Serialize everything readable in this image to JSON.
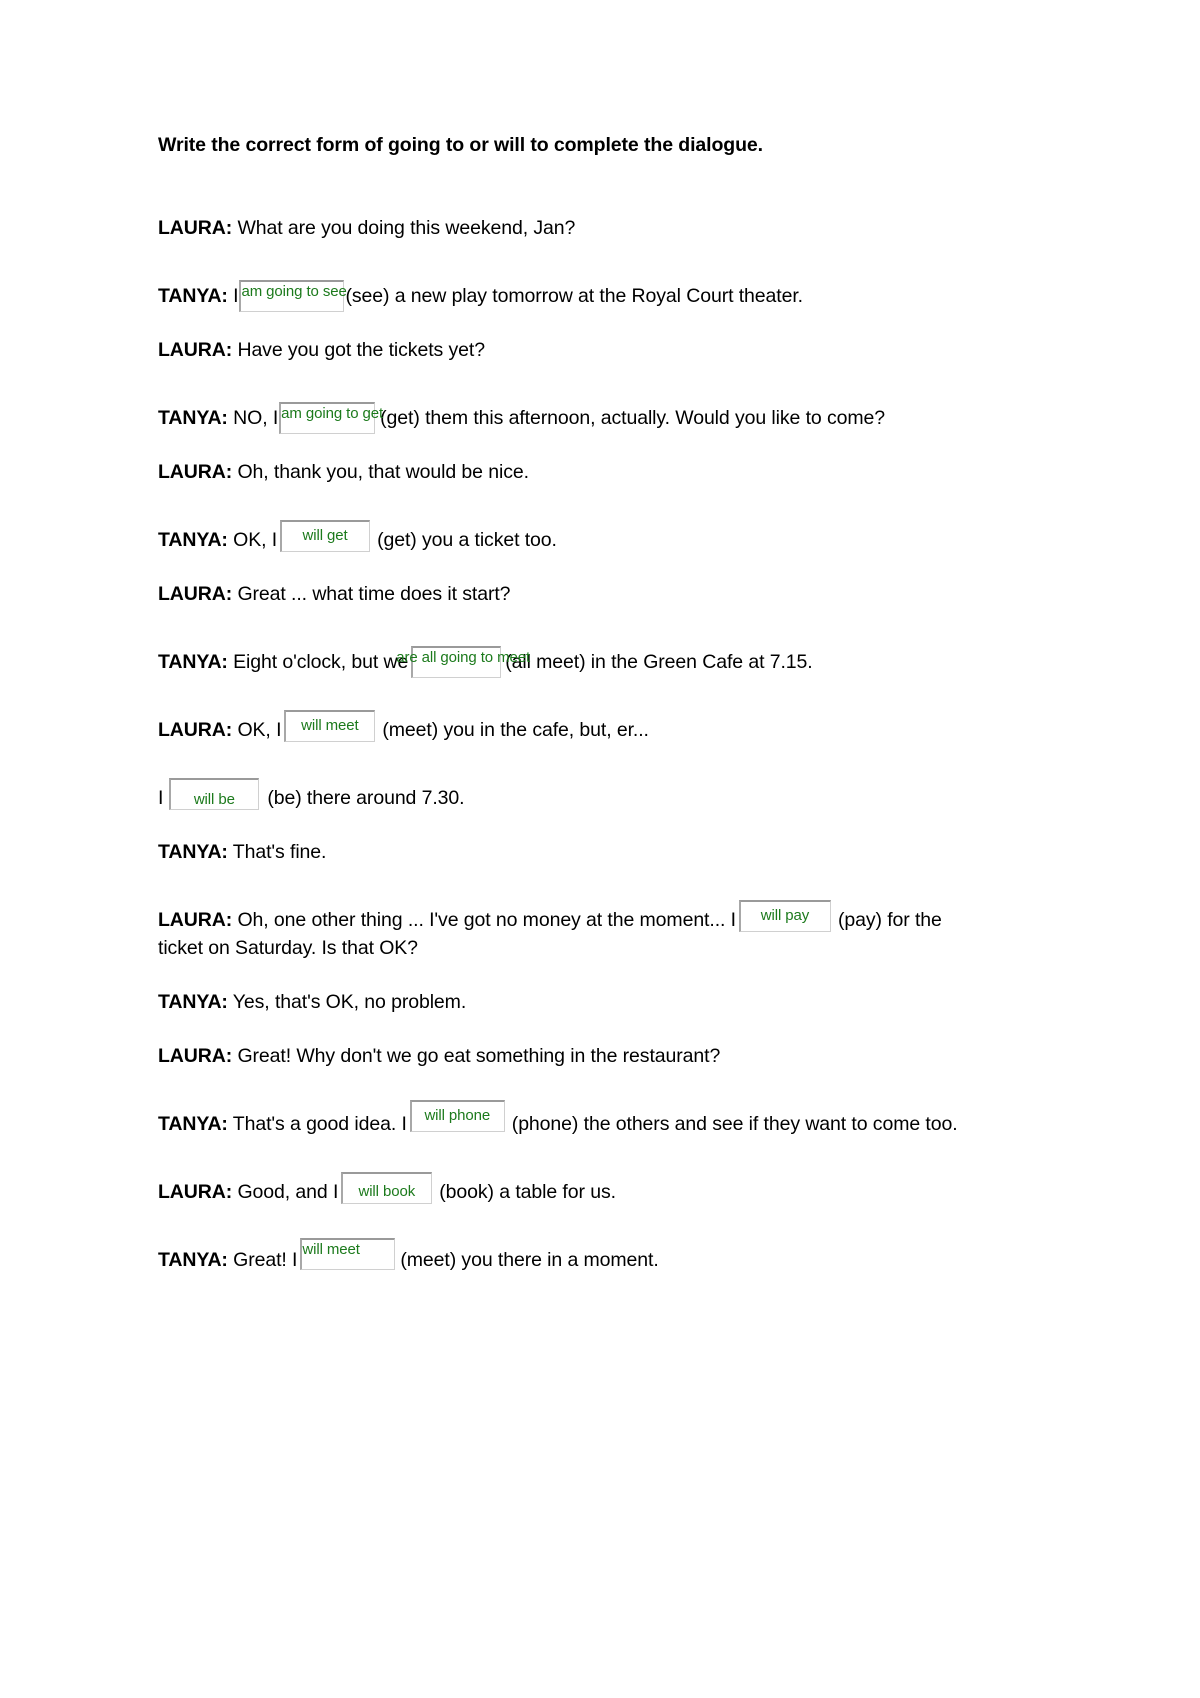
{
  "document": {
    "title": "Write the correct form of going to or will to complete the dialogue.",
    "answer_color": "#1c7a1c",
    "box_border_color": "#9a9a9a"
  },
  "dialogue": [
    {
      "speaker": "LAURA:",
      "before": " What are you doing this weekend, Jan?",
      "answer": null,
      "after": ""
    },
    {
      "speaker": "TANYA:",
      "before": " I",
      "answer": "am going to see",
      "after": "(see) a new play tomorrow at the Royal Court theater."
    },
    {
      "speaker": "LAURA:",
      "before": " Have you got the tickets yet?",
      "answer": null,
      "after": ""
    },
    {
      "speaker": "TANYA:",
      "before": " NO, I",
      "answer": "am going to get",
      "after": "(get) them this afternoon, actually. Would you like to come?"
    },
    {
      "speaker": "LAURA:",
      "before": " Oh, thank you, that would be nice.",
      "answer": null,
      "after": ""
    },
    {
      "speaker": "TANYA:",
      "before": " OK, I",
      "answer": "will get",
      "after": "(get) you a ticket too."
    },
    {
      "speaker": "LAURA:",
      "before": " Great ... what time does it start?",
      "answer": null,
      "after": ""
    },
    {
      "speaker": "TANYA:",
      "before": " Eight o'clock, but we",
      "answer": "are all going to meet",
      "after": "(all meet) in the Green Cafe at 7.15."
    },
    {
      "speaker": "LAURA:",
      "before": " OK, I",
      "answer": "will meet",
      "after": "(meet) you in the cafe, but, er..."
    },
    {
      "speaker": "",
      "before": "I",
      "answer": "will be",
      "after": "(be) there around 7.30."
    },
    {
      "speaker": "TANYA:",
      "before": " That's fine.",
      "answer": null,
      "after": ""
    },
    {
      "speaker": "LAURA:",
      "before": " Oh, one other thing ... I've got no money at the moment... I",
      "answer": "will pay",
      "after": "(pay) for the ticket on Saturday. Is that OK?"
    },
    {
      "speaker": "TANYA:",
      "before": " Yes, that's OK, no problem.",
      "answer": null,
      "after": ""
    },
    {
      "speaker": "LAURA:",
      "before": " Great! Why don't we go eat something in the restaurant?",
      "answer": null,
      "after": ""
    },
    {
      "speaker": "TANYA:",
      "before": " That's a good idea. I",
      "answer": "will phone",
      "after": "(phone) the others and see if they want to come too."
    },
    {
      "speaker": "LAURA:",
      "before": " Good, and I",
      "answer": "will book",
      "after": "(book) a table for us."
    },
    {
      "speaker": "TANYA:",
      "before": " Great! I",
      "answer": "will meet",
      "after": "(meet) you there in a moment."
    }
  ]
}
